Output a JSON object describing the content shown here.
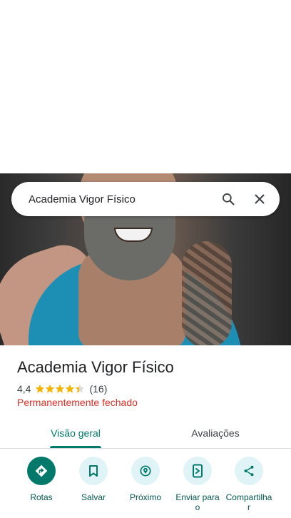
{
  "search": {
    "query": "Academia Vigor Físico"
  },
  "place": {
    "name": "Academia Vigor Físico",
    "rating": "4,4",
    "stars": 4.4,
    "reviews": "(16)",
    "status": "Permanentemente fechado"
  },
  "tabs": [
    {
      "label": "Visão geral",
      "active": true
    },
    {
      "label": "Avaliações",
      "active": false
    }
  ],
  "actions": [
    {
      "label": "Rotas",
      "icon": "directions-icon"
    },
    {
      "label": "Salvar",
      "icon": "bookmark-icon"
    },
    {
      "label": "Próximo",
      "icon": "nearby-icon"
    },
    {
      "label": "Enviar para o",
      "icon": "send-to-phone-icon"
    },
    {
      "label": "Compartilha r",
      "icon": "share-icon"
    }
  ],
  "colors": {
    "accent": "#00796b",
    "status": "#d93025",
    "star": "#f4b400"
  }
}
